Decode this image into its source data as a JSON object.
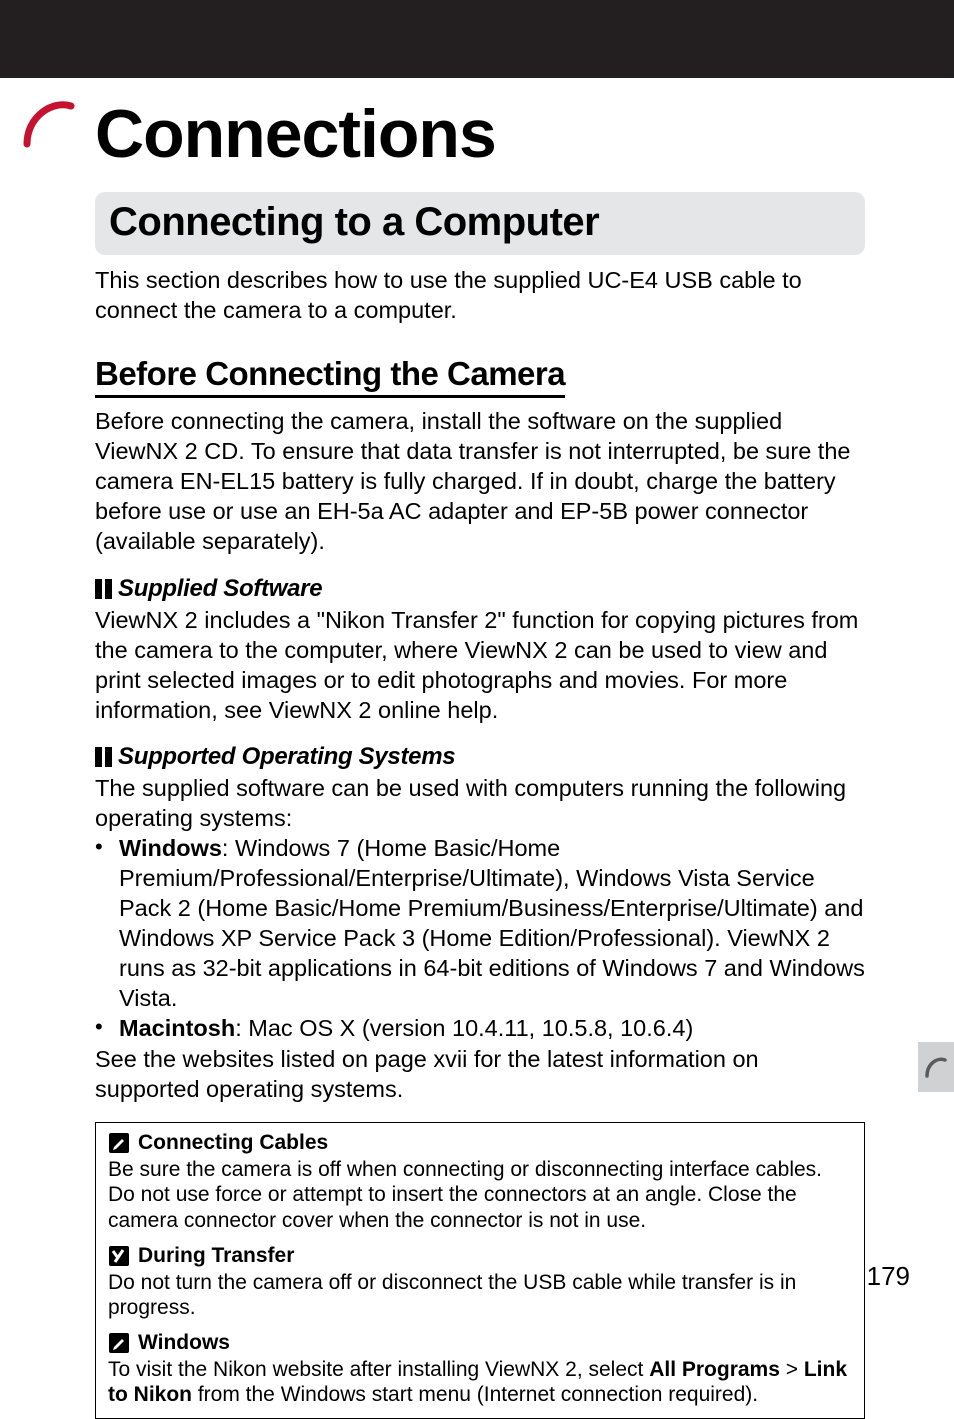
{
  "chapter": {
    "icon_name": "connections-curve-icon",
    "title": "Connections"
  },
  "h1": {
    "title": "Connecting to a Computer"
  },
  "intro": "This section describes how to use the supplied UC-E4 USB cable to connect the camera to a computer.",
  "h2": {
    "title": "Before Connecting the Camera"
  },
  "before_body": "Before connecting the camera, install the software on the supplied ViewNX 2 CD.  To ensure that data transfer is not interrupted, be sure the camera EN-EL15 battery is fully charged.  If in doubt, charge the battery before use or use an EH-5a AC adapter and EP-5B power connector (available separately).",
  "supplied": {
    "title": "Supplied Software",
    "body": "ViewNX 2 includes a \"Nikon Transfer 2\" function for copying pictures from the camera to the computer, where ViewNX 2 can be used to view and print selected images or to edit photographs and movies.  For more information, see ViewNX 2 online help."
  },
  "supported": {
    "title": "Supported Operating Systems",
    "intro": "The supplied software can be used with computers running the following operating systems:",
    "bullets": [
      {
        "label": "Windows",
        "text": ": Windows 7 (Home Basic/Home Premium/Professional/Enterprise/Ultimate), Windows Vista Service Pack 2 (Home Basic/Home Premium/Business/Enterprise/Ultimate) and Windows XP Service Pack 3 (Home Edition/Professional).  ViewNX 2 runs as 32-bit applications in 64-bit editions of Windows 7 and Windows Vista."
      },
      {
        "label": "Macintosh",
        "text": ": Mac OS X (version 10.4.11, 10.5.8, 10.6.4)"
      }
    ],
    "outro": "See the websites listed on page xvii for the latest information on supported operating systems."
  },
  "notes": {
    "cables": {
      "icon": "note-pencil-icon",
      "title": "Connecting Cables",
      "body": "Be sure the camera is off when connecting or disconnecting interface cables.  Do not use force or attempt to insert the connectors at an angle.  Close the camera connector cover when the connector is not in use."
    },
    "transfer": {
      "icon": "caution-icon",
      "title": "During Transfer",
      "body": "Do not turn the camera off or disconnect the USB cable while transfer is in progress."
    },
    "windows": {
      "icon": "note-pencil-icon",
      "title": "Windows",
      "body_pre": "To visit the Nikon website after installing ViewNX 2, select ",
      "bold1": "All Programs",
      "sep": " > ",
      "bold2": "Link to Nikon",
      "body_post": " from the Windows start menu (Internet connection required)."
    }
  },
  "page_number": "179"
}
